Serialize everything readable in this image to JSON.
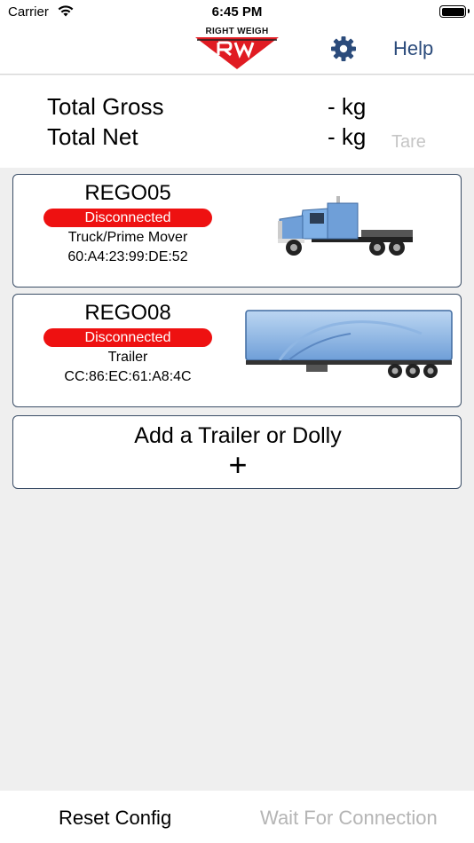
{
  "status_bar": {
    "carrier": "Carrier",
    "time": "6:45 PM"
  },
  "nav": {
    "logo_text": "RIGHT WEIGH",
    "logo_letters": "RW",
    "settings_icon": "gear-icon",
    "help_label": "Help"
  },
  "totals": {
    "gross_label": "Total Gross",
    "gross_value": "- kg",
    "net_label": "Total Net",
    "net_value": "- kg",
    "tare_label": "Tare"
  },
  "vehicles": [
    {
      "name": "REGO05",
      "status": "Disconnected",
      "type": "Truck/Prime Mover",
      "mac": "60:A4:23:99:DE:52",
      "image": "prime-mover-truck"
    },
    {
      "name": "REGO08",
      "status": "Disconnected",
      "type": "Trailer",
      "mac": "CC:86:EC:61:A8:4C",
      "image": "curtainsider-trailer"
    }
  ],
  "add_card": {
    "label": "Add a Trailer or Dolly",
    "icon": "plus-icon"
  },
  "bottom": {
    "reset_label": "Reset Config",
    "wait_label": "Wait For Connection"
  },
  "colors": {
    "disconnected": "#ee1111",
    "help": "#2b4b7b",
    "card_border": "#3a4d66",
    "logo_red": "#e01b22",
    "vehicle_blue": "#6f9fd8"
  }
}
